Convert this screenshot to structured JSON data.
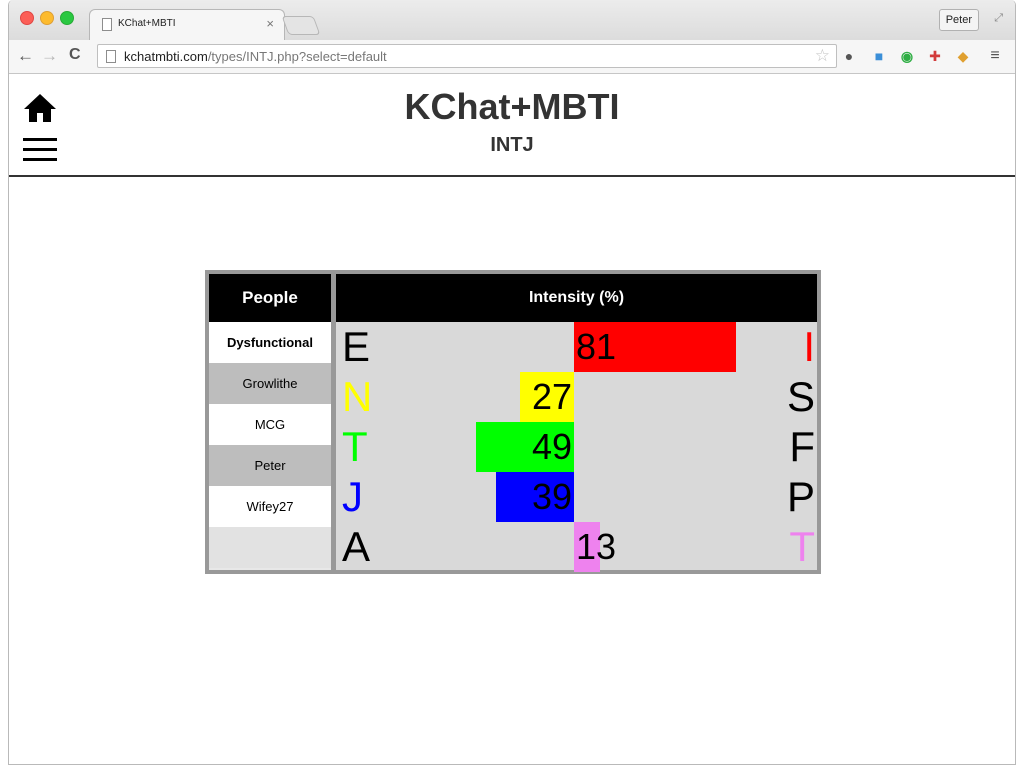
{
  "browser": {
    "tab_title": "KChat+MBTI",
    "tab_close": "×",
    "profile": "Peter",
    "url_domain": "kchatmbti.com",
    "url_path": "/types/INTJ.php?select=default",
    "nav": {
      "back": "←",
      "forward": "→",
      "reload": "C"
    },
    "star": "☆",
    "menu": "≡"
  },
  "header": {
    "title": "KChat+MBTI",
    "subtitle": "INTJ"
  },
  "table": {
    "people_header": "People",
    "intensity_header": "Intensity (%)",
    "people": [
      {
        "name": "Dysfunctional",
        "selected": true
      },
      {
        "name": "Growlithe",
        "selected": false
      },
      {
        "name": "MCG",
        "selected": false
      },
      {
        "name": "Peter",
        "selected": false
      },
      {
        "name": "Wifey27",
        "selected": false
      }
    ],
    "dimensions": [
      {
        "left": "E",
        "right": "I",
        "value": 81,
        "value_label": "81",
        "side": "right",
        "color": "#ff0000",
        "left_color": "#000000",
        "right_color": "#ff0000"
      },
      {
        "left": "N",
        "right": "S",
        "value": 27,
        "value_label": "27",
        "side": "left",
        "color": "#ffff00",
        "left_color": "#ffff00",
        "right_color": "#000000"
      },
      {
        "left": "T",
        "right": "F",
        "value": 49,
        "value_label": "49",
        "side": "left",
        "color": "#00ff00",
        "left_color": "#00ff00",
        "right_color": "#000000"
      },
      {
        "left": "J",
        "right": "P",
        "value": 39,
        "value_label": "39",
        "side": "left",
        "color": "#0000ff",
        "left_color": "#0000ff",
        "right_color": "#000000"
      },
      {
        "left": "A",
        "right": "T",
        "value": 13,
        "value_label": "13",
        "side": "right",
        "color": "#ee82ee",
        "left_color": "#000000",
        "right_color": "#ee82ee"
      }
    ]
  }
}
